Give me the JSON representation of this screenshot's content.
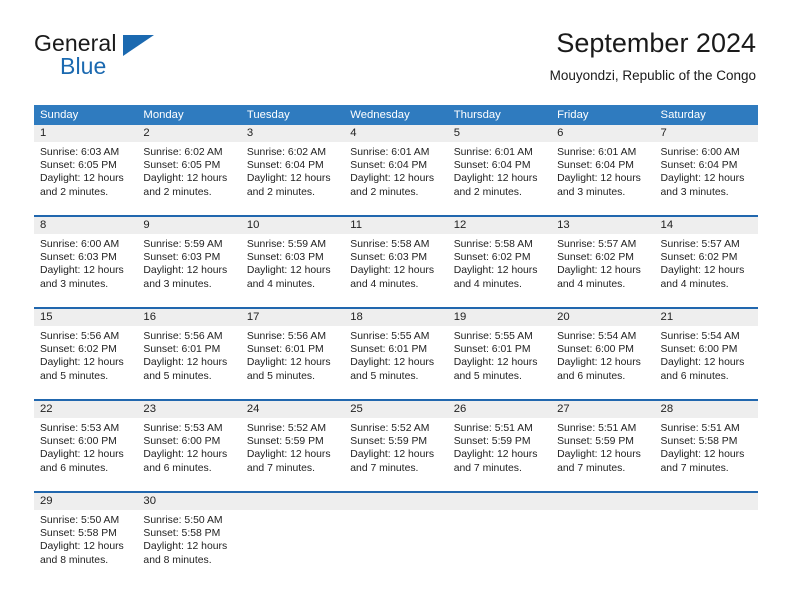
{
  "brand": {
    "name_part1": "General",
    "name_part2": "Blue",
    "mark": "triangle-logo",
    "accent_color": "#1b69b0"
  },
  "header": {
    "title": "September 2024",
    "subtitle": "Mouyondzi, Republic of the Congo"
  },
  "theme": {
    "header_row_bg": "#2f7bbf",
    "row_border": "#2167ae",
    "daynum_band_bg": "#eeeeee",
    "text": "#222222"
  },
  "weekdays": [
    "Sunday",
    "Monday",
    "Tuesday",
    "Wednesday",
    "Thursday",
    "Friday",
    "Saturday"
  ],
  "weeks": [
    [
      {
        "day": "1",
        "sunrise": "Sunrise: 6:03 AM",
        "sunset": "Sunset: 6:05 PM",
        "daylight1": "Daylight: 12 hours",
        "daylight2": "and 2 minutes."
      },
      {
        "day": "2",
        "sunrise": "Sunrise: 6:02 AM",
        "sunset": "Sunset: 6:05 PM",
        "daylight1": "Daylight: 12 hours",
        "daylight2": "and 2 minutes."
      },
      {
        "day": "3",
        "sunrise": "Sunrise: 6:02 AM",
        "sunset": "Sunset: 6:04 PM",
        "daylight1": "Daylight: 12 hours",
        "daylight2": "and 2 minutes."
      },
      {
        "day": "4",
        "sunrise": "Sunrise: 6:01 AM",
        "sunset": "Sunset: 6:04 PM",
        "daylight1": "Daylight: 12 hours",
        "daylight2": "and 2 minutes."
      },
      {
        "day": "5",
        "sunrise": "Sunrise: 6:01 AM",
        "sunset": "Sunset: 6:04 PM",
        "daylight1": "Daylight: 12 hours",
        "daylight2": "and 2 minutes."
      },
      {
        "day": "6",
        "sunrise": "Sunrise: 6:01 AM",
        "sunset": "Sunset: 6:04 PM",
        "daylight1": "Daylight: 12 hours",
        "daylight2": "and 3 minutes."
      },
      {
        "day": "7",
        "sunrise": "Sunrise: 6:00 AM",
        "sunset": "Sunset: 6:04 PM",
        "daylight1": "Daylight: 12 hours",
        "daylight2": "and 3 minutes."
      }
    ],
    [
      {
        "day": "8",
        "sunrise": "Sunrise: 6:00 AM",
        "sunset": "Sunset: 6:03 PM",
        "daylight1": "Daylight: 12 hours",
        "daylight2": "and 3 minutes."
      },
      {
        "day": "9",
        "sunrise": "Sunrise: 5:59 AM",
        "sunset": "Sunset: 6:03 PM",
        "daylight1": "Daylight: 12 hours",
        "daylight2": "and 3 minutes."
      },
      {
        "day": "10",
        "sunrise": "Sunrise: 5:59 AM",
        "sunset": "Sunset: 6:03 PM",
        "daylight1": "Daylight: 12 hours",
        "daylight2": "and 4 minutes."
      },
      {
        "day": "11",
        "sunrise": "Sunrise: 5:58 AM",
        "sunset": "Sunset: 6:03 PM",
        "daylight1": "Daylight: 12 hours",
        "daylight2": "and 4 minutes."
      },
      {
        "day": "12",
        "sunrise": "Sunrise: 5:58 AM",
        "sunset": "Sunset: 6:02 PM",
        "daylight1": "Daylight: 12 hours",
        "daylight2": "and 4 minutes."
      },
      {
        "day": "13",
        "sunrise": "Sunrise: 5:57 AM",
        "sunset": "Sunset: 6:02 PM",
        "daylight1": "Daylight: 12 hours",
        "daylight2": "and 4 minutes."
      },
      {
        "day": "14",
        "sunrise": "Sunrise: 5:57 AM",
        "sunset": "Sunset: 6:02 PM",
        "daylight1": "Daylight: 12 hours",
        "daylight2": "and 4 minutes."
      }
    ],
    [
      {
        "day": "15",
        "sunrise": "Sunrise: 5:56 AM",
        "sunset": "Sunset: 6:02 PM",
        "daylight1": "Daylight: 12 hours",
        "daylight2": "and 5 minutes."
      },
      {
        "day": "16",
        "sunrise": "Sunrise: 5:56 AM",
        "sunset": "Sunset: 6:01 PM",
        "daylight1": "Daylight: 12 hours",
        "daylight2": "and 5 minutes."
      },
      {
        "day": "17",
        "sunrise": "Sunrise: 5:56 AM",
        "sunset": "Sunset: 6:01 PM",
        "daylight1": "Daylight: 12 hours",
        "daylight2": "and 5 minutes."
      },
      {
        "day": "18",
        "sunrise": "Sunrise: 5:55 AM",
        "sunset": "Sunset: 6:01 PM",
        "daylight1": "Daylight: 12 hours",
        "daylight2": "and 5 minutes."
      },
      {
        "day": "19",
        "sunrise": "Sunrise: 5:55 AM",
        "sunset": "Sunset: 6:01 PM",
        "daylight1": "Daylight: 12 hours",
        "daylight2": "and 5 minutes."
      },
      {
        "day": "20",
        "sunrise": "Sunrise: 5:54 AM",
        "sunset": "Sunset: 6:00 PM",
        "daylight1": "Daylight: 12 hours",
        "daylight2": "and 6 minutes."
      },
      {
        "day": "21",
        "sunrise": "Sunrise: 5:54 AM",
        "sunset": "Sunset: 6:00 PM",
        "daylight1": "Daylight: 12 hours",
        "daylight2": "and 6 minutes."
      }
    ],
    [
      {
        "day": "22",
        "sunrise": "Sunrise: 5:53 AM",
        "sunset": "Sunset: 6:00 PM",
        "daylight1": "Daylight: 12 hours",
        "daylight2": "and 6 minutes."
      },
      {
        "day": "23",
        "sunrise": "Sunrise: 5:53 AM",
        "sunset": "Sunset: 6:00 PM",
        "daylight1": "Daylight: 12 hours",
        "daylight2": "and 6 minutes."
      },
      {
        "day": "24",
        "sunrise": "Sunrise: 5:52 AM",
        "sunset": "Sunset: 5:59 PM",
        "daylight1": "Daylight: 12 hours",
        "daylight2": "and 7 minutes."
      },
      {
        "day": "25",
        "sunrise": "Sunrise: 5:52 AM",
        "sunset": "Sunset: 5:59 PM",
        "daylight1": "Daylight: 12 hours",
        "daylight2": "and 7 minutes."
      },
      {
        "day": "26",
        "sunrise": "Sunrise: 5:51 AM",
        "sunset": "Sunset: 5:59 PM",
        "daylight1": "Daylight: 12 hours",
        "daylight2": "and 7 minutes."
      },
      {
        "day": "27",
        "sunrise": "Sunrise: 5:51 AM",
        "sunset": "Sunset: 5:59 PM",
        "daylight1": "Daylight: 12 hours",
        "daylight2": "and 7 minutes."
      },
      {
        "day": "28",
        "sunrise": "Sunrise: 5:51 AM",
        "sunset": "Sunset: 5:58 PM",
        "daylight1": "Daylight: 12 hours",
        "daylight2": "and 7 minutes."
      }
    ],
    [
      {
        "day": "29",
        "sunrise": "Sunrise: 5:50 AM",
        "sunset": "Sunset: 5:58 PM",
        "daylight1": "Daylight: 12 hours",
        "daylight2": "and 8 minutes."
      },
      {
        "day": "30",
        "sunrise": "Sunrise: 5:50 AM",
        "sunset": "Sunset: 5:58 PM",
        "daylight1": "Daylight: 12 hours",
        "daylight2": "and 8 minutes."
      },
      {
        "day": "",
        "sunrise": "",
        "sunset": "",
        "daylight1": "",
        "daylight2": ""
      },
      {
        "day": "",
        "sunrise": "",
        "sunset": "",
        "daylight1": "",
        "daylight2": ""
      },
      {
        "day": "",
        "sunrise": "",
        "sunset": "",
        "daylight1": "",
        "daylight2": ""
      },
      {
        "day": "",
        "sunrise": "",
        "sunset": "",
        "daylight1": "",
        "daylight2": ""
      },
      {
        "day": "",
        "sunrise": "",
        "sunset": "",
        "daylight1": "",
        "daylight2": ""
      }
    ]
  ]
}
